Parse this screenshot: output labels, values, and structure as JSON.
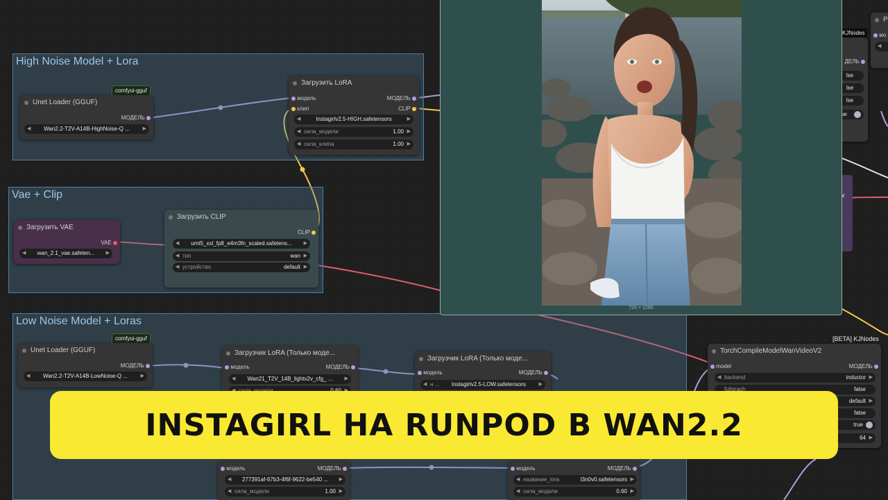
{
  "groups": {
    "high": "High Noise Model + Lora",
    "vae_clip": "Vae + Clip",
    "low": "Low Noise Model + Loras"
  },
  "badges": {
    "comfyui_gguf": "comfyui-gguf",
    "kjnodes": "KJNodes",
    "beta_kjnodes": "[BETA] KJNodes"
  },
  "unet_high": {
    "title": "Unet Loader (GGUF)",
    "out": "МОДЕЛЬ",
    "unet_name": "Wan2.2-T2V-A14B-HighNoise-Q ..."
  },
  "lora_high": {
    "title": "Загрузить LoRA",
    "in_model": "модель",
    "in_clip": "клип",
    "out_model": "МОДЕЛЬ",
    "out_clip": "CLIP",
    "lora_name": "Instagirlv2.5-HIGH.safetensors",
    "strength_model_label": "сила_модели",
    "strength_model": "1.00",
    "strength_clip_label": "сила_клипа",
    "strength_clip": "1.00"
  },
  "vae": {
    "title": "Загрузить VAE",
    "out": "VAE",
    "vae_name": "wan_2.1_vae.safeten..."
  },
  "clip": {
    "title": "Загрузить CLIP",
    "out": "CLIP",
    "clip_name": "umt5_xxl_fp8_e4m3fn_scaled.safetens...",
    "type_label": "тип",
    "type_value": "wan",
    "device_label": "устройство",
    "device_value": "default"
  },
  "preview": {
    "dims": "720 × 1280"
  },
  "unet_low": {
    "title": "Unet Loader (GGUF)",
    "out": "МОДЕЛЬ",
    "unet_name": "Wan2.2-T2V-A14B-LowNoise-Q ..."
  },
  "lora_low1": {
    "title": "Загрузчик LoRA (Только моде...",
    "in_model": "модель",
    "out_model": "МОДЕЛЬ",
    "lora_name": "Wan21_T2V_14B_lightx2v_cfg_ ...",
    "strength_label": "сила_модели",
    "strength": "0.60"
  },
  "lora_low2": {
    "title": "Загрузчик LoRA (Только моде...",
    "in_model": "модель",
    "out_model": "МОДЕЛЬ",
    "lora_prefix": "н ...",
    "lora_name": "Instagirlv2.5-LOW.safetensors"
  },
  "lora_bottom1": {
    "in_model": "модель",
    "out_model": "МОДЕЛЬ",
    "lora_name": "277391af-67b3-4f6f-9622-be540 ...",
    "strength_label": "сила_модели",
    "strength": "1.00"
  },
  "lora_bottom2": {
    "in_model": "модель",
    "out_model": "МОДЕЛЬ",
    "lora_label": "название_lora",
    "lora_name": "l3n0v0.safetensors",
    "strength_label": "сила_модели",
    "strength": "0.60"
  },
  "right_partial": {
    "title_initial": "P",
    "in_model": "мо",
    "out_model": "ДЕЛЬ",
    "rows": [
      "lse",
      "lse",
      "lse",
      "true"
    ],
    "letter_v": "v"
  },
  "torch_compile": {
    "title": "TorchCompileModelWanVideoV2",
    "in_model": "model",
    "out_model": "МОДЕЛЬ",
    "backend_label": "backend",
    "backend_value": "inductor",
    "fullgraph_label": "fullgraph",
    "fullgraph_value": "false",
    "mode_value": "default",
    "row4_value": "false",
    "row5_value": "true",
    "row6_value": "64"
  },
  "banner": {
    "text": "INSTAGIRL НА RUNPOD В WAN2.2",
    "color": "#f9e932"
  },
  "colors": {
    "model_wire": "#b39ddb",
    "clip_wire": "#f2c94c",
    "vae_wire": "#e05d6a",
    "group_fill": "#3f6480"
  }
}
